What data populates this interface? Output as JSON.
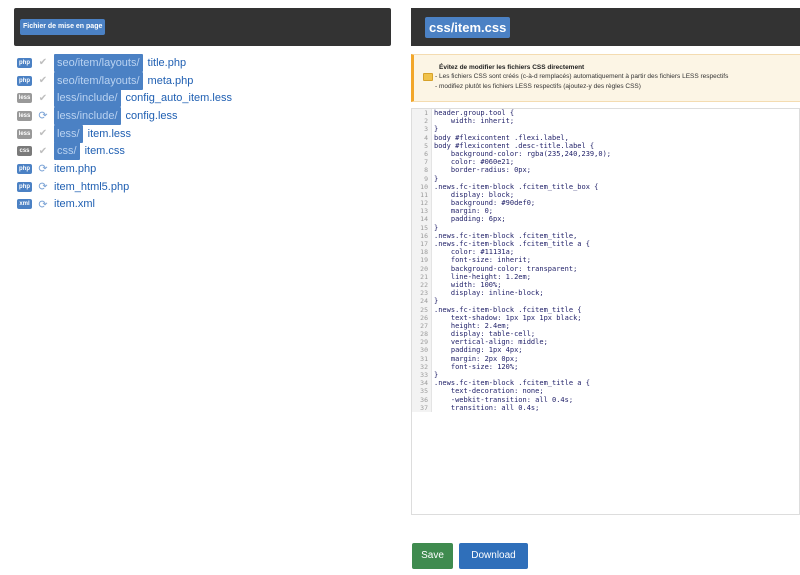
{
  "left_panel": {
    "title": "Fichier de mise en page",
    "files": [
      {
        "type": "php",
        "status_icon": "check-icon",
        "path": "seo/item/layouts/",
        "name": "title.php"
      },
      {
        "type": "php",
        "status_icon": "check-icon",
        "path": "seo/item/layouts/",
        "name": "meta.php"
      },
      {
        "type": "less",
        "status_icon": "check-icon",
        "path": "less/include/",
        "name": "config_auto_item.less"
      },
      {
        "type": "less",
        "status_icon": "link-icon",
        "path": "less/include/",
        "name": "config.less"
      },
      {
        "type": "less",
        "status_icon": "check-icon",
        "path": "less/",
        "name": "item.less"
      },
      {
        "type": "css",
        "status_icon": "check-icon",
        "path": "css/",
        "name": "item.css"
      },
      {
        "type": "php",
        "status_icon": "link-icon",
        "path": "",
        "name": "item.php"
      },
      {
        "type": "php",
        "status_icon": "link-icon",
        "path": "",
        "name": "item_html5.php"
      },
      {
        "type": "xml",
        "status_icon": "link-icon",
        "path": "",
        "name": "item.xml"
      }
    ]
  },
  "right_panel": {
    "title": "css/item.css",
    "warning": {
      "title": "Évitez de modifier les fichiers CSS directement",
      "line1": "- Les fichiers CSS sont créés (c-à-d remplacés) automatiquement à partir des fichiers LESS respectifs",
      "line2": "- modifiez plutôt les fichiers LESS respectifs (ajoutez-y des règles CSS)"
    },
    "code_lines": [
      "header.group.tool {",
      "    width: inherit;",
      "}",
      "body #flexicontent .flexi.label,",
      "body #flexicontent .desc-title.label {",
      "    background-color: rgba(235,240,239,0);",
      "    color: #060e21;",
      "    border-radius: 0px;",
      "}",
      ".news.fc-item-block .fcitem_title_box {",
      "    display: block;",
      "    background: #90def0;",
      "    margin: 0;",
      "    padding: 6px;",
      "}",
      ".news.fc-item-block .fcitem_title,",
      ".news.fc-item-block .fcitem_title a {",
      "    color: #11131a;",
      "    font-size: inherit;",
      "    background-color: transparent;",
      "    line-height: 1.2em;",
      "    width: 100%;",
      "    display: inline-block;",
      "}",
      ".news.fc-item-block .fcitem_title {",
      "    text-shadow: 1px 1px 1px black;",
      "    height: 2.4em;",
      "    display: table-cell;",
      "    vertical-align: middle;",
      "    padding: 1px 4px;",
      "    margin: 2px 0px;",
      "    font-size: 120%;",
      "}",
      ".news.fc-item-block .fcitem_title a {",
      "    text-decoration: none;",
      "    -webkit-transition: all 0.4s;",
      "    transition: all 0.4s;"
    ]
  },
  "buttons": {
    "save_label": "Save",
    "download_label": "Download"
  },
  "colors": {
    "header_bg": "#333333",
    "accent_blue": "#4b81c4",
    "save_green": "#3f8b4f",
    "download_blue": "#2f6fba",
    "warning_orange": "#f2a72b"
  }
}
